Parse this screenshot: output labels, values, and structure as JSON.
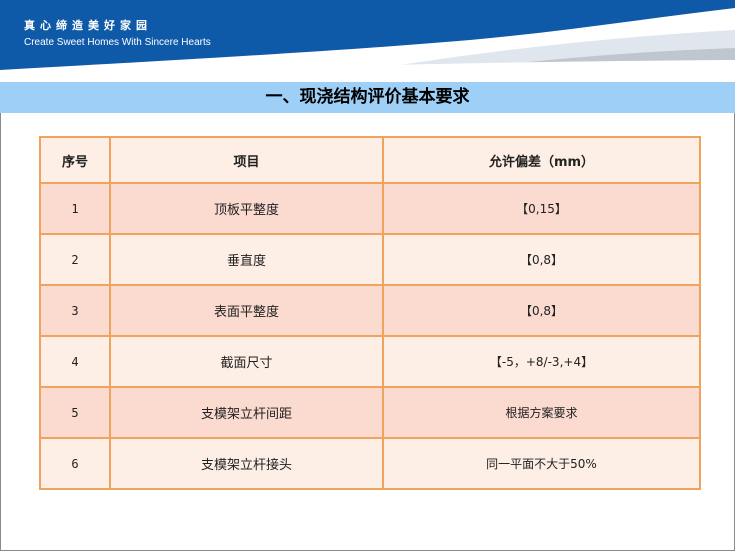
{
  "header": {
    "slogan_cn": "真心缔造美好家园",
    "slogan_en": "Create Sweet Homes With Sincere Hearts",
    "colors": {
      "banner": "#0f5aa8",
      "title_bar": "#9ed0f7"
    }
  },
  "page": {
    "title": "一、现浇结构评价基本要求"
  },
  "table": {
    "columns": [
      "序号",
      "项目",
      "允许偏差（mm）"
    ],
    "rows": [
      {
        "no": "1",
        "item": "顶板平整度",
        "tolerance": "【0,15】"
      },
      {
        "no": "2",
        "item": "垂直度",
        "tolerance": "【0,8】"
      },
      {
        "no": "3",
        "item": "表面平整度",
        "tolerance": "【0,8】"
      },
      {
        "no": "4",
        "item": "截面尺寸",
        "tolerance": "【-5，+8/-3,+4】"
      },
      {
        "no": "5",
        "item": "支模架立杆间距",
        "tolerance": "根据方案要求"
      },
      {
        "no": "6",
        "item": "支模架立杆接头",
        "tolerance": "同一平面不大于50%"
      }
    ],
    "colors": {
      "border": "#f0a35e",
      "row_dark": "#fbdad0",
      "row_light": "#fdeee6"
    }
  }
}
